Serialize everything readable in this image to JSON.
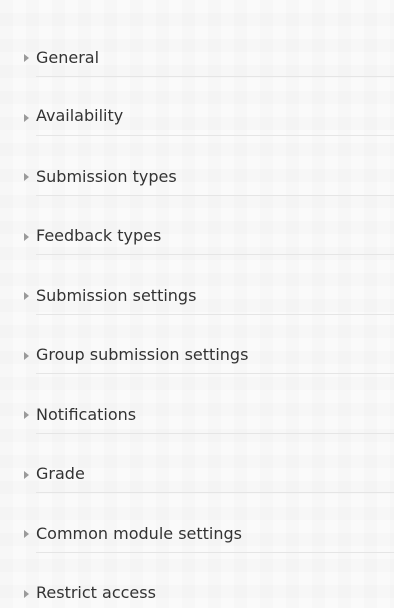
{
  "sections": [
    {
      "label": "General"
    },
    {
      "label": "Availability"
    },
    {
      "label": "Submission types"
    },
    {
      "label": "Feedback types"
    },
    {
      "label": "Submission settings"
    },
    {
      "label": "Group submission settings"
    },
    {
      "label": "Notifications"
    },
    {
      "label": "Grade"
    },
    {
      "label": "Common module settings"
    },
    {
      "label": "Restrict access"
    }
  ],
  "colors": {
    "text": "#333333",
    "arrow": "#9a9a9a",
    "divider": "#e5e5e5",
    "background": "#fafafa"
  },
  "icons": {
    "expand": "triangle-right-icon"
  }
}
